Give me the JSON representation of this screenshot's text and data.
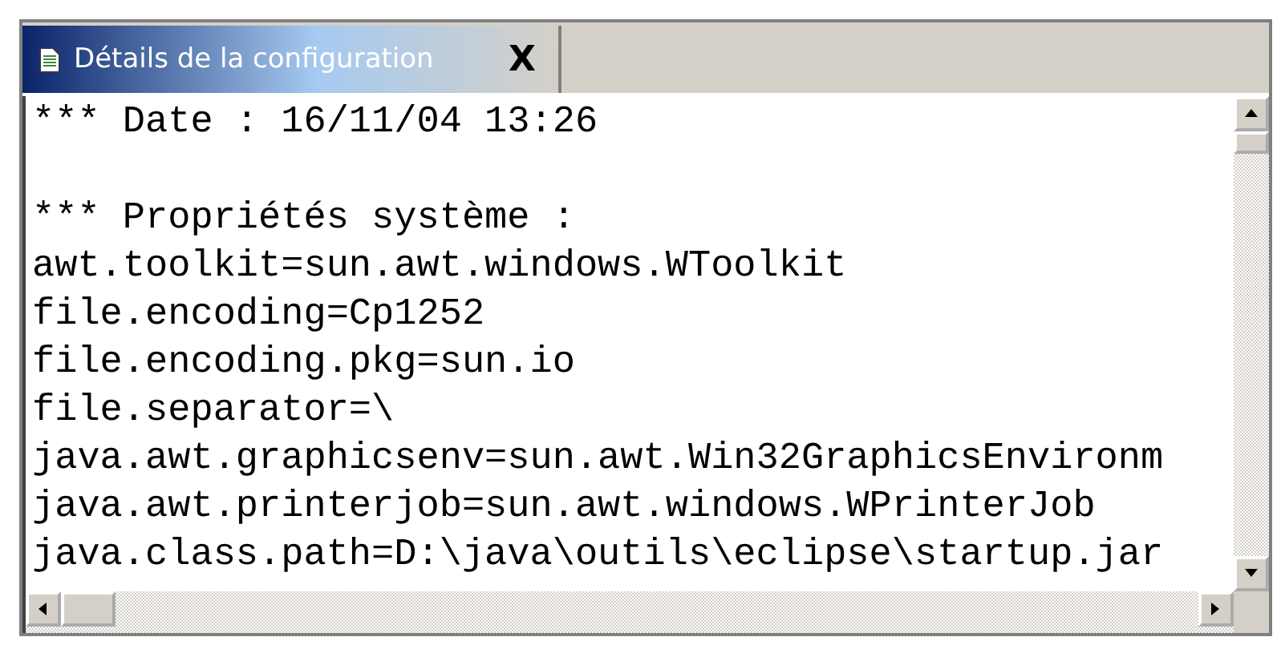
{
  "tab": {
    "title": "Détails de la configuration",
    "close": "X",
    "selected": true
  },
  "sections": [
    [
      "*** Date : 16/11/04 13:26"
    ],
    [
      "*** Propriétés système :",
      "awt.toolkit=sun.awt.windows.WToolkit",
      "file.encoding=Cp1252",
      "file.encoding.pkg=sun.io",
      "file.separator=\\",
      "java.awt.graphicsenv=sun.awt.Win32GraphicsEnvironm",
      "java.awt.printerjob=sun.awt.windows.WPrinterJob",
      "java.class.path=D:\\java\\outils\\eclipse\\startup.jar"
    ]
  ]
}
